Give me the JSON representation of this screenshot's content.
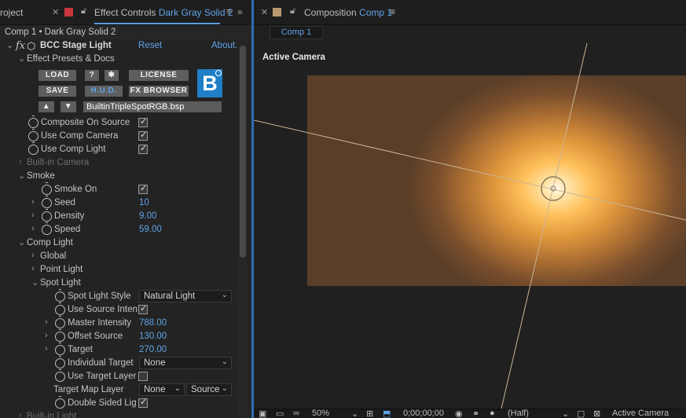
{
  "left_panel": {
    "tab_project": "roject",
    "tab_effect_prefix": "Effect Controls",
    "tab_effect_layer": "Dark Gray Solid 2",
    "breadcrumb": "Comp 1 • Dark Gray Solid 2",
    "effect": {
      "fx_label": "fx",
      "name": "BCC Stage Light",
      "reset": "Reset",
      "about": "About..."
    },
    "presets_label": "Effect Presets & Docs",
    "buttons": {
      "load": "LOAD",
      "help": "?",
      "license": "LICENSE",
      "save": "SAVE",
      "hud": "H.U.D.",
      "fx_browser": "FX BROWSER"
    },
    "logo_letter": "B",
    "preset_file": "BuiltinTripleSpotRGB.bsp",
    "props": {
      "composite_on_source": "Composite On Source",
      "use_comp_camera": "Use Comp Camera",
      "use_comp_light": "Use Comp Light",
      "builtin_camera": "Built-in Camera",
      "smoke": "Smoke",
      "smoke_on": "Smoke On",
      "seed": "Seed",
      "seed_val": "10",
      "density": "Density",
      "density_val": "9.00",
      "speed": "Speed",
      "speed_val": "59.00",
      "comp_light": "Comp Light",
      "global": "Global",
      "point_light": "Point Light",
      "spot_light": "Spot Light",
      "spot_light_style": "Spot Light Style",
      "spot_light_style_val": "Natural Light",
      "use_source_inten": "Use Source Inten",
      "master_intensity": "Master Intensity",
      "master_intensity_val": "788.00",
      "offset_source": "Offset Source",
      "offset_source_val": "130.00",
      "target": "Target",
      "target_val": "270.00",
      "individual_target": "Individual Target",
      "individual_target_val": "None",
      "use_target_layer": "Use Target Layer",
      "target_map_layer": "Target Map Layer",
      "target_map_layer_val": "None",
      "target_map_source": "Source",
      "double_sided_lig": "Double Sided Lig",
      "builtin_light": "Built-in Light"
    }
  },
  "right_panel": {
    "tab_prefix": "Composition",
    "tab_comp": "Comp 1",
    "comp_tab": "Comp 1",
    "viewer_label": "Active Camera",
    "bottom": {
      "zoom": "50%",
      "timecode": "0;00;00;00",
      "resolution": "(Half)",
      "view": "Active Camera"
    }
  },
  "colors": {
    "accent_blue": "#5fa3e6",
    "label_red": "#c8353a",
    "label_tan": "#b99870",
    "panel_divider": "#2d6fb3"
  }
}
